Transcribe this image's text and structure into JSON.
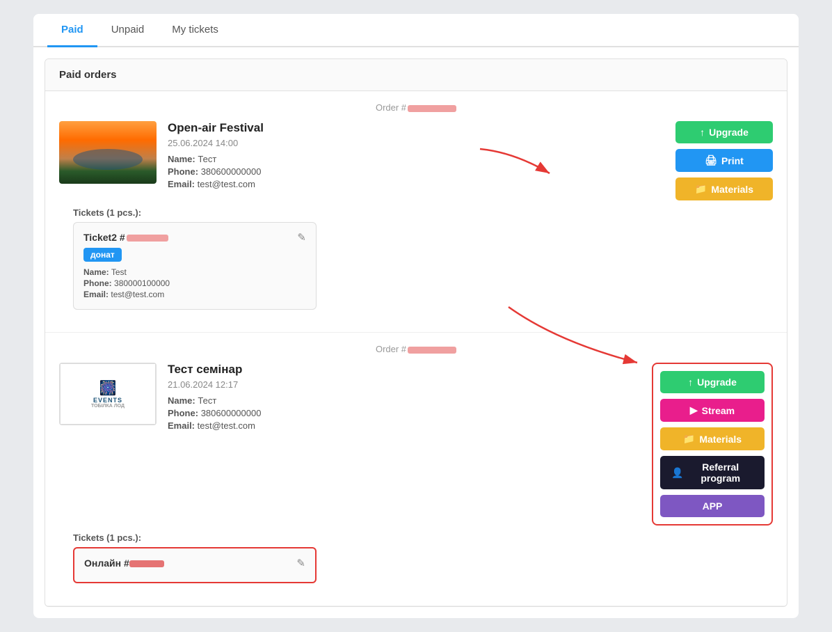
{
  "tabs": [
    {
      "label": "Paid",
      "active": true
    },
    {
      "label": "Unpaid",
      "active": false
    },
    {
      "label": "My tickets",
      "active": false
    }
  ],
  "section": {
    "title": "Paid orders"
  },
  "order1": {
    "order_label": "Order #",
    "event_title": "Open-air Festival",
    "event_date": "25.06.2024 14:00",
    "name_label": "Name:",
    "name_value": "Тест",
    "phone_label": "Phone:",
    "phone_value": "380600000000",
    "email_label": "Email:",
    "email_value": "test@test.com",
    "buttons": {
      "upgrade": "Upgrade",
      "print": "Print",
      "materials": "Materials"
    },
    "tickets_label": "Tickets (1 pcs.):",
    "ticket": {
      "name": "Ticket2 #",
      "badge": "донат",
      "name_label": "Name:",
      "name_value": "Test",
      "phone_label": "Phone:",
      "phone_value": "380000100000",
      "email_label": "Email:",
      "email_value": "test@test.com"
    }
  },
  "order2": {
    "order_label": "Order #",
    "event_title": "Тест семінар",
    "event_date": "21.06.2024 12:17",
    "name_label": "Name:",
    "name_value": "Тест",
    "phone_label": "Phone:",
    "phone_value": "380600000000",
    "email_label": "Email:",
    "email_value": "test@test.com",
    "buttons": {
      "upgrade": "Upgrade",
      "stream": "Stream",
      "materials": "Materials",
      "referral": "Referral program",
      "app": "APP"
    },
    "tickets_label": "Tickets (1 pcs.):",
    "ticket": {
      "name": "Онлайн #"
    }
  },
  "icons": {
    "upgrade": "↑",
    "print": "🖨",
    "materials": "📁",
    "stream": "▶",
    "referral": "👤",
    "app": "APP",
    "edit": "✎"
  }
}
